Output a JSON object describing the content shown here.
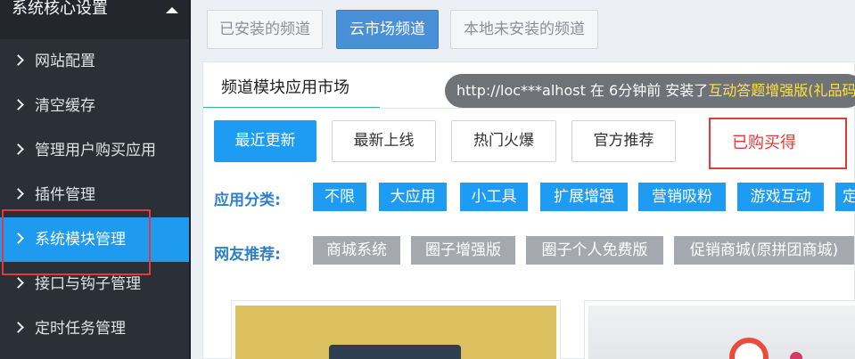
{
  "sidebar": {
    "header": "系统核心设置",
    "items": [
      {
        "label": "网站配置"
      },
      {
        "label": "清空缓存"
      },
      {
        "label": "管理用户购买应用"
      },
      {
        "label": "插件管理"
      },
      {
        "label": "系统模块管理"
      },
      {
        "label": "接口与钩子管理"
      },
      {
        "label": "定时任务管理"
      }
    ],
    "active_index": 4
  },
  "top_tabs": [
    {
      "label": "已安装的频道"
    },
    {
      "label": "云市场频道"
    },
    {
      "label": "本地未安装的频道"
    }
  ],
  "panel": {
    "tab_label": "频道模块应用市场",
    "ticker": {
      "prefix": "http://loc***alhost 在 6分钟前 安装了",
      "highlight": "互动答题增强版(礼品码"
    },
    "filters": [
      {
        "label": "最近更新"
      },
      {
        "label": "最新上线"
      },
      {
        "label": "热门火爆"
      },
      {
        "label": "官方推荐"
      }
    ],
    "purchased_label": "已购买得",
    "category_label": "应用分类:",
    "categories": [
      "不限",
      "大应用",
      "小工具",
      "扩展增强",
      "营销吸粉",
      "游戏互动",
      "定"
    ],
    "recommend_label": "网友推荐:",
    "recommendations": [
      "商城系统",
      "圈子增强版",
      "圈子个人免费版",
      "促销商城(原拼团商城)"
    ]
  },
  "colors": {
    "accent": "#1e9bf2",
    "sidebar_bg": "#2b3038",
    "highlight_text": "#ffe23a",
    "annotation_red": "#e03a3a"
  }
}
